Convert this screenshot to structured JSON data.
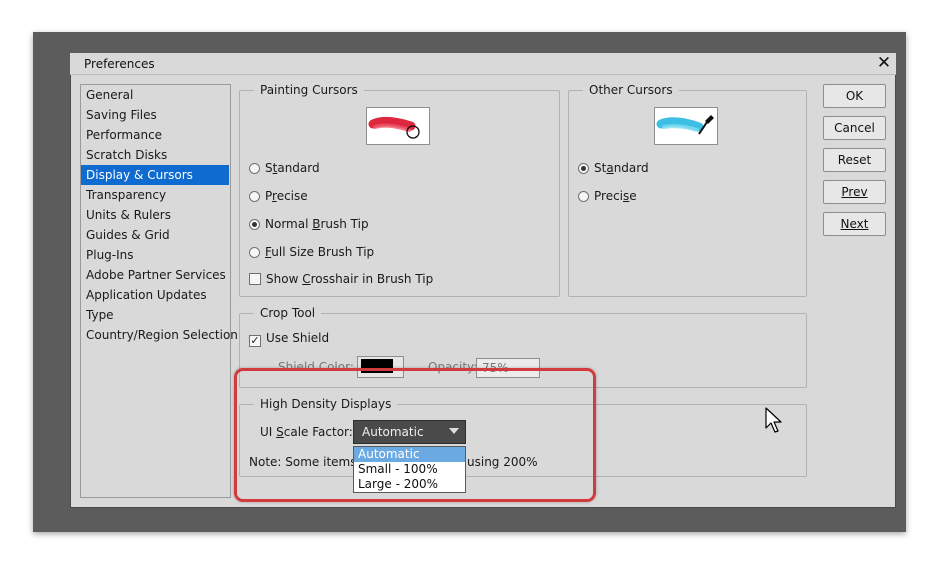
{
  "window": {
    "title": "Preferences",
    "close_icon": "close-icon"
  },
  "sidebar": {
    "items": [
      {
        "label": "General"
      },
      {
        "label": "Saving Files"
      },
      {
        "label": "Performance"
      },
      {
        "label": "Scratch Disks"
      },
      {
        "label": "Display & Cursors",
        "selected": true
      },
      {
        "label": "Transparency"
      },
      {
        "label": "Units & Rulers"
      },
      {
        "label": "Guides & Grid"
      },
      {
        "label": "Plug-Ins"
      },
      {
        "label": "Adobe Partner Services"
      },
      {
        "label": "Application Updates"
      },
      {
        "label": "Type"
      },
      {
        "label": "Country/Region Selection"
      }
    ]
  },
  "painting_cursors": {
    "legend": "Painting Cursors",
    "preview_icon": "red-brush-stroke-icon",
    "options": [
      {
        "pre": "S",
        "u": "t",
        "post": "andard",
        "checked": false
      },
      {
        "pre": "P",
        "u": "r",
        "post": "ecise",
        "checked": false
      },
      {
        "pre": "Normal ",
        "u": "B",
        "post": "rush Tip",
        "checked": true
      },
      {
        "pre": "",
        "u": "F",
        "post": "ull Size Brush Tip",
        "checked": false
      }
    ],
    "crosshair": {
      "pre": "Show ",
      "u": "C",
      "post": "rosshair in Brush Tip",
      "checked": false
    }
  },
  "other_cursors": {
    "legend": "Other Cursors",
    "preview_icon": "eyedropper-icon",
    "options": [
      {
        "pre": "St",
        "u": "a",
        "post": "ndard",
        "checked": true
      },
      {
        "pre": "Preci",
        "u": "s",
        "post": "e",
        "checked": false
      }
    ]
  },
  "crop_tool": {
    "legend": "Crop Tool",
    "use_shield": "Use Shield",
    "use_shield_checked": true,
    "shield_color_label": "Shield Color:",
    "opacity_label": "Opacity:",
    "opacity_value": "75%"
  },
  "high_density": {
    "legend": "High Density Displays",
    "scale_label_pre": "UI ",
    "scale_label_u": "S",
    "scale_label_post": "cale Factor:",
    "selected": "Automatic",
    "note_left": "Note: Some items",
    "note_right": "using 200%",
    "options": [
      "Automatic",
      "Small - 100%",
      "Large - 200%"
    ]
  },
  "buttons": {
    "ok": "OK",
    "cancel": "Cancel",
    "reset": "Reset",
    "prev": "Prev",
    "next": "Next"
  },
  "colors": {
    "selection": "#0f6bd0",
    "highlight_ring": "#d13b3b",
    "dropdown_highlight": "#6aa9e2"
  }
}
